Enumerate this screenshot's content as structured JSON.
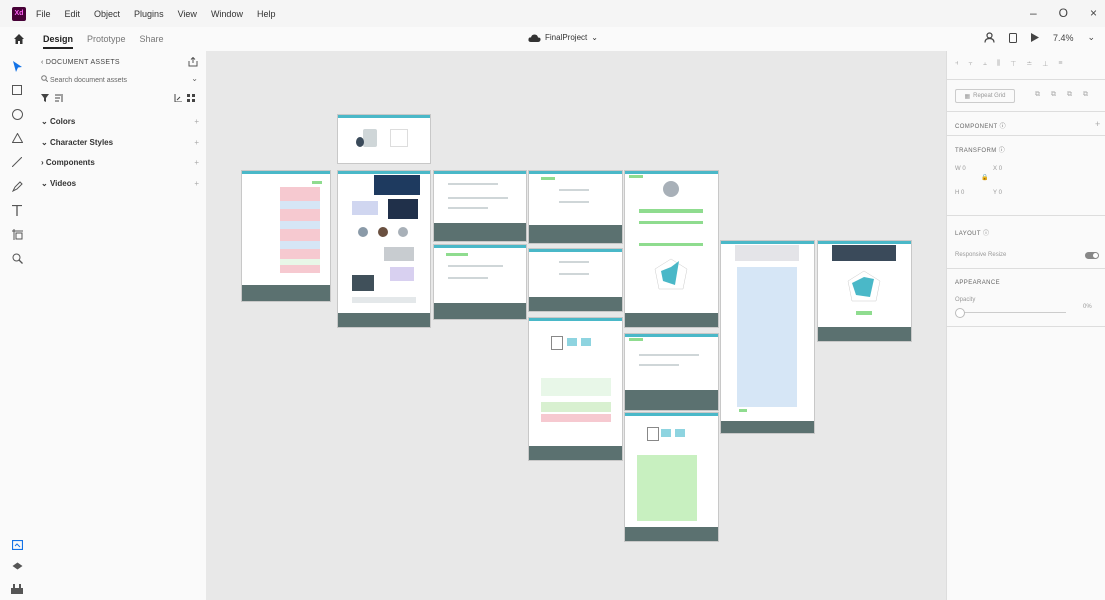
{
  "app": {
    "logo": "Xd"
  },
  "menu": [
    "File",
    "Edit",
    "Object",
    "Plugins",
    "View",
    "Window",
    "Help"
  ],
  "window_controls": [
    "–",
    "O",
    "×"
  ],
  "tabs": [
    "Design",
    "Prototype",
    "Share"
  ],
  "project": {
    "title": "FinalProject",
    "chevron": "⌄"
  },
  "right_tools": {
    "zoom": "7.4%",
    "chevron": "⌄"
  },
  "assets": {
    "header": "‹ DOCUMENT ASSETS",
    "search_placeholder": "Search document assets",
    "sections": [
      {
        "arrow": "⌄",
        "label": "Colors",
        "plus": "+"
      },
      {
        "arrow": "⌄",
        "label": "Character Styles",
        "plus": "+"
      },
      {
        "arrow": "›",
        "label": "Components",
        "plus": "+"
      },
      {
        "arrow": "⌄",
        "label": "Videos",
        "plus": "+"
      }
    ]
  },
  "props": {
    "repeat_grid": "Repeat Grid",
    "component_label": "COMPONENT",
    "component_plus": "+",
    "transform_label": "TRANSFORM",
    "w_label": "W",
    "w_value": "0",
    "h_label": "H",
    "h_value": "0",
    "x_label": "X",
    "x_value": "0",
    "y_label": "Y",
    "y_value": "0",
    "layout_label": "LAYOUT",
    "responsive_label": "Responsive Resize",
    "appearance_label": "APPEARANCE",
    "opacity_label": "Opacity",
    "opacity_value": "0%"
  },
  "colors": {
    "artboard_header": "#4ab8c8",
    "artboard_footer": "#5b7170",
    "accent_green": "#8fdc8f",
    "accent_pink": "#f6c9d0",
    "accent_blue": "#d6e6f6"
  }
}
